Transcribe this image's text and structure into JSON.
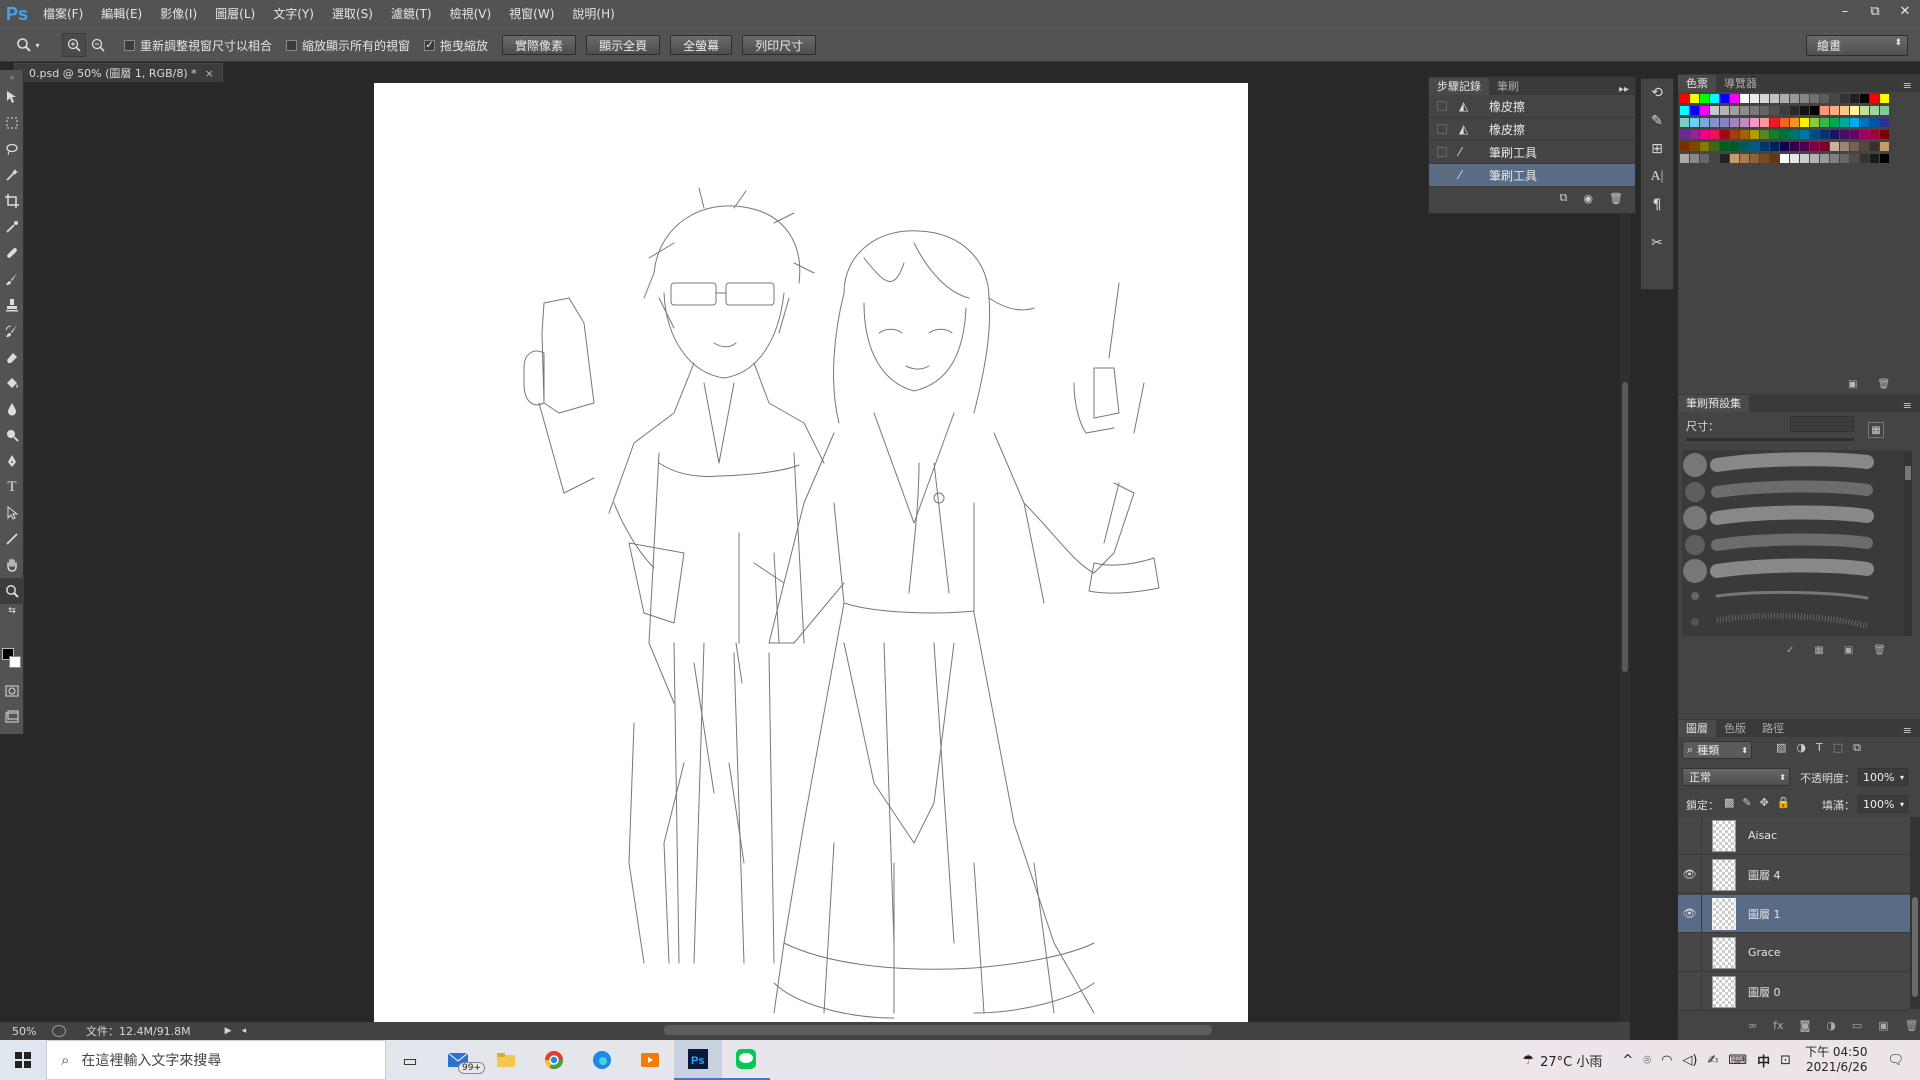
{
  "app": {
    "logo": "Ps"
  },
  "menu": [
    "檔案(F)",
    "編輯(E)",
    "影像(I)",
    "圖層(L)",
    "文字(Y)",
    "選取(S)",
    "濾鏡(T)",
    "檢視(V)",
    "視窗(W)",
    "說明(H)"
  ],
  "window_controls": {
    "minimize": "–",
    "restore": "⧉",
    "close": "✕"
  },
  "options_bar": {
    "checks": [
      {
        "label": "重新調整視窗尺寸以相合",
        "checked": false
      },
      {
        "label": "縮放顯示所有的視窗",
        "checked": false
      },
      {
        "label": "拖曳縮放",
        "checked": true
      }
    ],
    "buttons": [
      "實際像素",
      "顯示全頁",
      "全螢幕",
      "列印尺寸"
    ],
    "workspace": "繪畫"
  },
  "document_tab": {
    "title": "0.psd @ 50% (圖層 1, RGB/8) *"
  },
  "status_bar": {
    "zoom": "50%",
    "doc_info": "文件：12.4M/91.8M"
  },
  "history_panel": {
    "tabs": [
      "步驟記錄",
      "筆刷"
    ],
    "items": [
      {
        "label": "橡皮擦",
        "icon": "eraser-icon",
        "selected": false
      },
      {
        "label": "橡皮擦",
        "icon": "eraser-icon",
        "selected": false
      },
      {
        "label": "筆刷工具",
        "icon": "brush-icon",
        "selected": false
      },
      {
        "label": "筆刷工具",
        "icon": "brush-icon",
        "selected": true
      }
    ]
  },
  "swatches_panel": {
    "tabs": [
      "色票",
      "導覽器"
    ]
  },
  "brush_presets": {
    "title": "筆刷預設集",
    "size_label": "尺寸："
  },
  "layers_panel": {
    "tabs": [
      "圖層",
      "色版",
      "路徑"
    ],
    "filter": "種類",
    "blend_mode": "正常",
    "opacity_label": "不透明度：",
    "opacity": "100%",
    "lock_label": "鎖定：",
    "fill_label": "填滿：",
    "fill": "100%",
    "layers": [
      {
        "name": "Aisac",
        "visible": false,
        "selected": false
      },
      {
        "name": "圖層 4",
        "visible": true,
        "selected": false
      },
      {
        "name": "圖層 1",
        "visible": true,
        "selected": true
      },
      {
        "name": "Grace",
        "visible": false,
        "selected": false
      },
      {
        "name": "圖層 0",
        "visible": false,
        "selected": false
      }
    ]
  },
  "taskbar": {
    "search_placeholder": "在這裡輸入文字來搜尋",
    "mail_badge": "99+",
    "weather": "27°C 小雨",
    "ime": "中",
    "time": "下午 04:50",
    "date": "2021/6/26"
  },
  "colors": {
    "ui_bg": "#535353",
    "panel_bg": "#444444",
    "selected": "#5a6b85",
    "ps_blue": "#3ea4ff"
  }
}
